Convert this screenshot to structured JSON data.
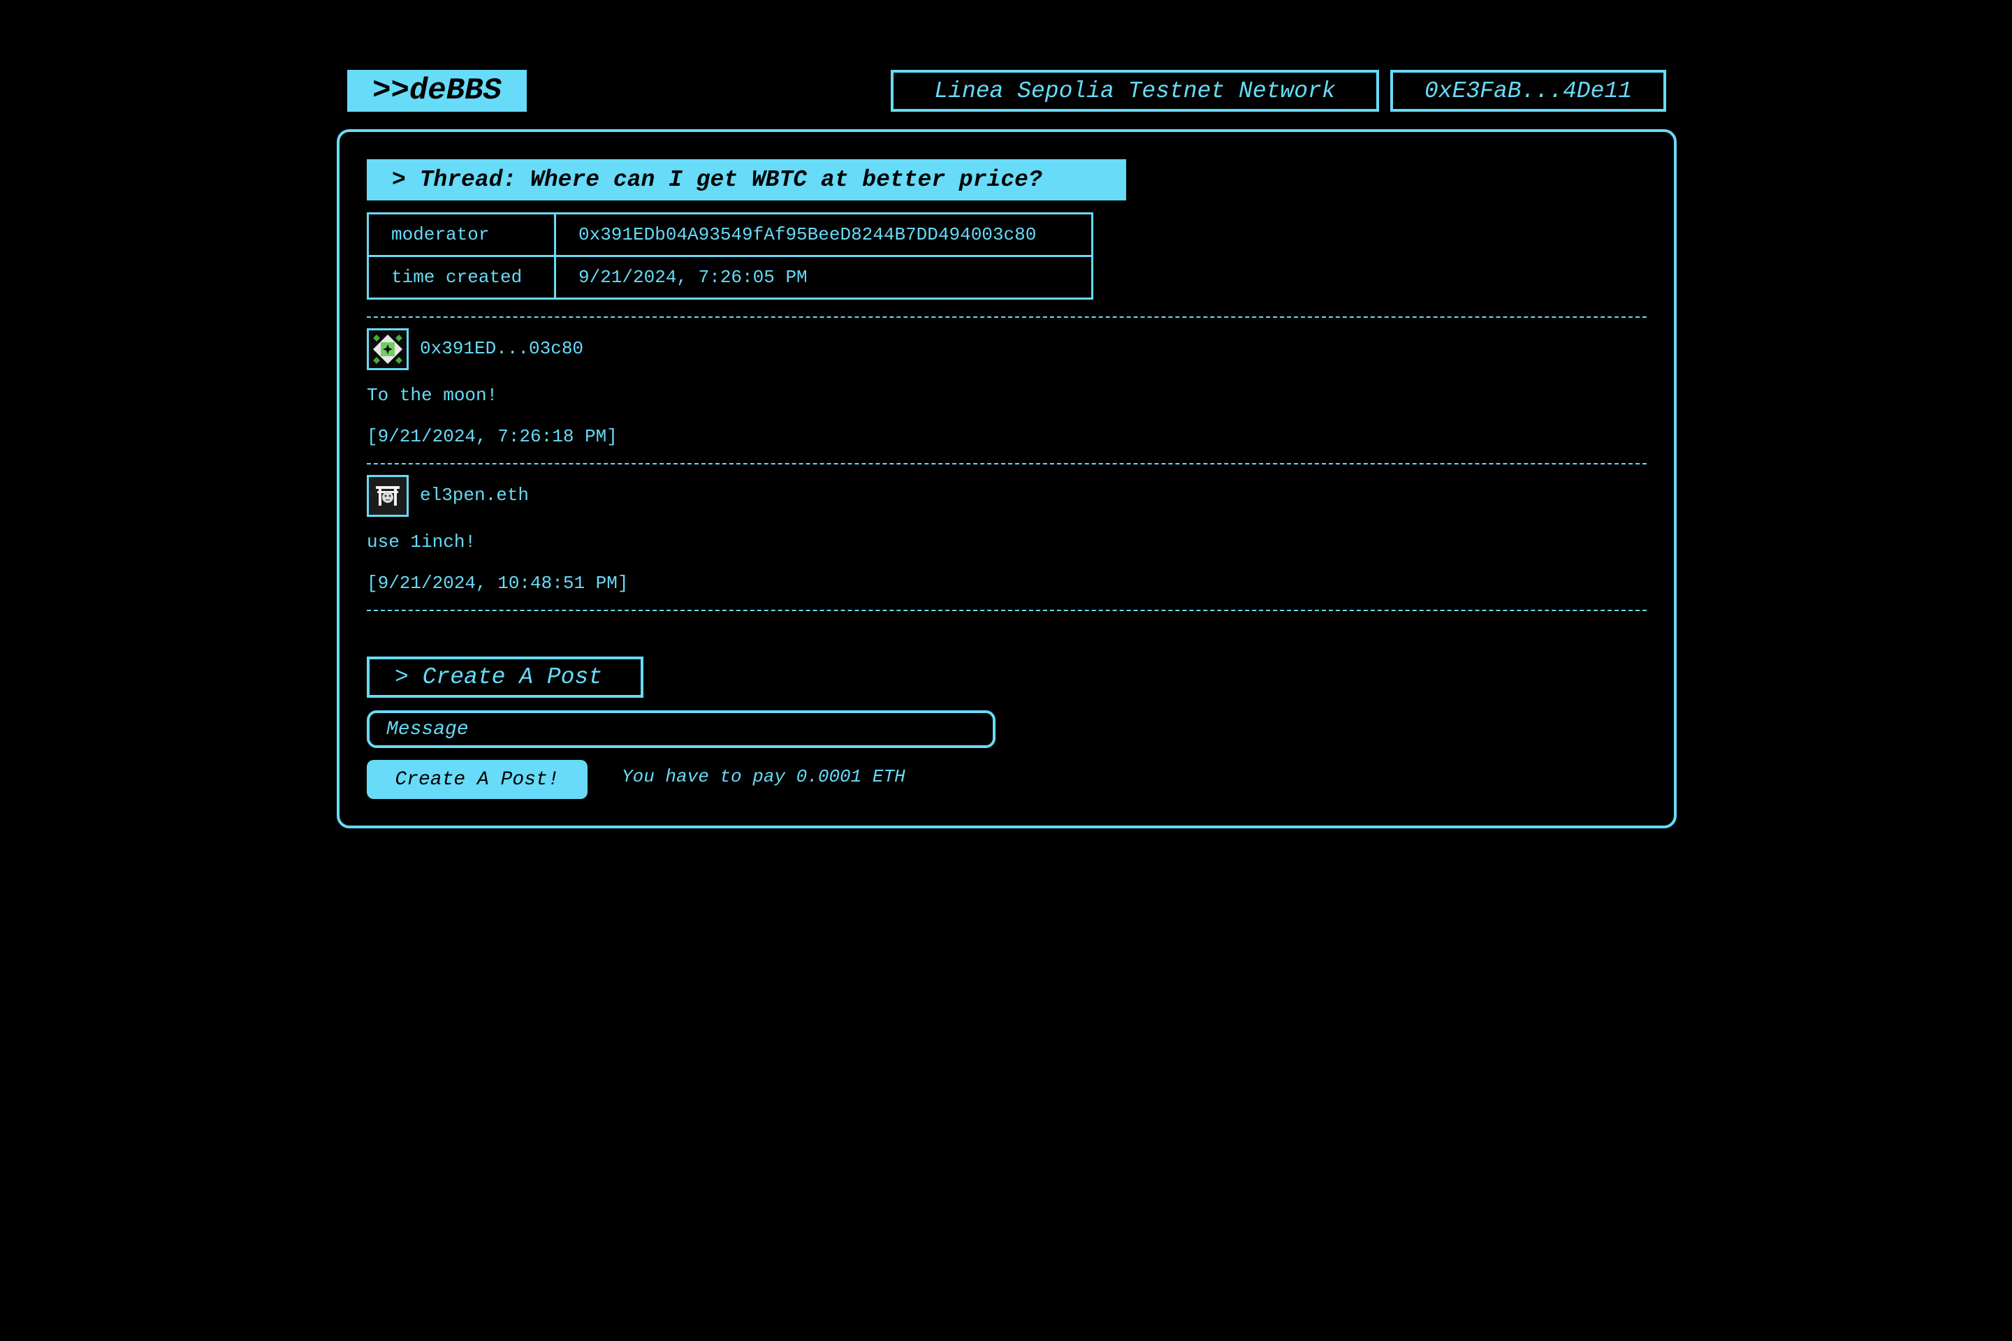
{
  "header": {
    "logo": ">>deBBS",
    "network": "Linea Sepolia Testnet Network",
    "account": "0xE3FaB...4De11"
  },
  "thread": {
    "title": "> Thread: Where can I get WBTC at better price?",
    "meta": [
      {
        "key": "moderator",
        "value": "0x391EDb04A93549fAf95BeeD8244B7DD494003c80"
      },
      {
        "key": "time created",
        "value": "9/21/2024, 7:26:05 PM"
      }
    ]
  },
  "posts": [
    {
      "author": "0x391ED...03c80",
      "avatar_icon": "green-diamond-identicon",
      "body": "To the moon!",
      "timestamp": "[9/21/2024, 7:26:18 PM]"
    },
    {
      "author": "el3pen.eth",
      "avatar_icon": "torii-face-avatar",
      "body": "use 1inch!",
      "timestamp": "[9/21/2024, 10:48:51 PM]"
    }
  ],
  "create_post": {
    "heading": "> Create A Post",
    "message_placeholder": "Message",
    "message_value": "",
    "submit_label": "Create A Post!",
    "fee_note": "You have to pay 0.0001 ETH"
  },
  "colors": {
    "accent": "#67dbf7",
    "background": "#000000"
  }
}
